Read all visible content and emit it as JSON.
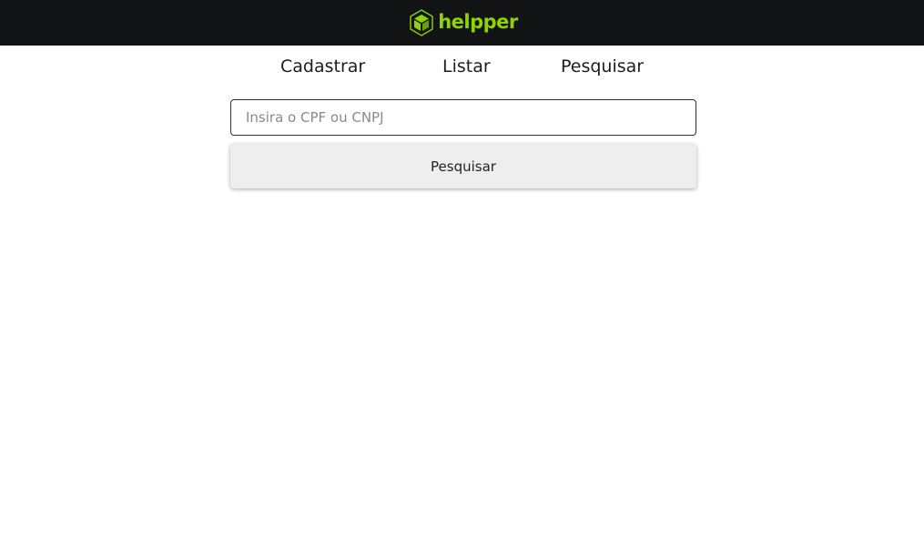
{
  "header": {
    "brand_name": "helpper",
    "brand_color": "#8fd400",
    "background_color": "#121314",
    "logo_icon": "cube-icon"
  },
  "nav": {
    "items": [
      {
        "label": "Cadastrar"
      },
      {
        "label": "Listar"
      },
      {
        "label": "Pesquisar"
      }
    ]
  },
  "search": {
    "placeholder": "Insira o CPF ou CNPJ",
    "value": "",
    "button_label": "Pesquisar"
  }
}
